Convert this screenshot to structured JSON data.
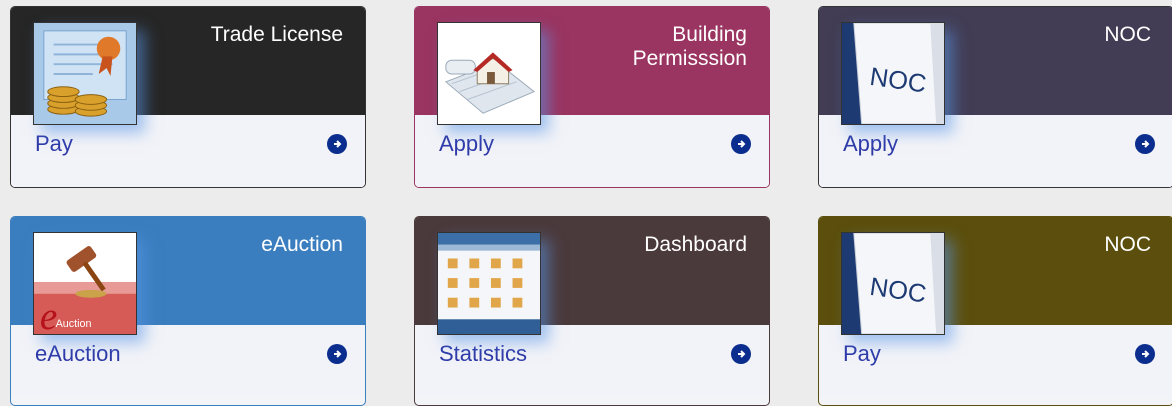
{
  "tiles": [
    {
      "title": "Trade License",
      "action": "Pay",
      "header_color": "#262626",
      "icon": "trade-license-icon"
    },
    {
      "title": "Building Permisssion",
      "action": "Apply",
      "header_color": "#9a3460",
      "icon": "building-permission-icon"
    },
    {
      "title": "NOC",
      "action": "Apply",
      "header_color": "#423d55",
      "icon": "noc-icon"
    },
    {
      "title": "eAuction",
      "action": "eAuction",
      "header_color": "#3a7ebf",
      "icon": "eauction-icon"
    },
    {
      "title": "Dashboard",
      "action": "Statistics",
      "header_color": "#4b3a3c",
      "icon": "dashboard-icon"
    },
    {
      "title": "NOC",
      "action": "Pay",
      "header_color": "#5c4f0d",
      "icon": "noc-icon"
    }
  ],
  "thumb_text": {
    "noc": "NOC",
    "eauction": "Auction",
    "eauction_letter": "e"
  }
}
